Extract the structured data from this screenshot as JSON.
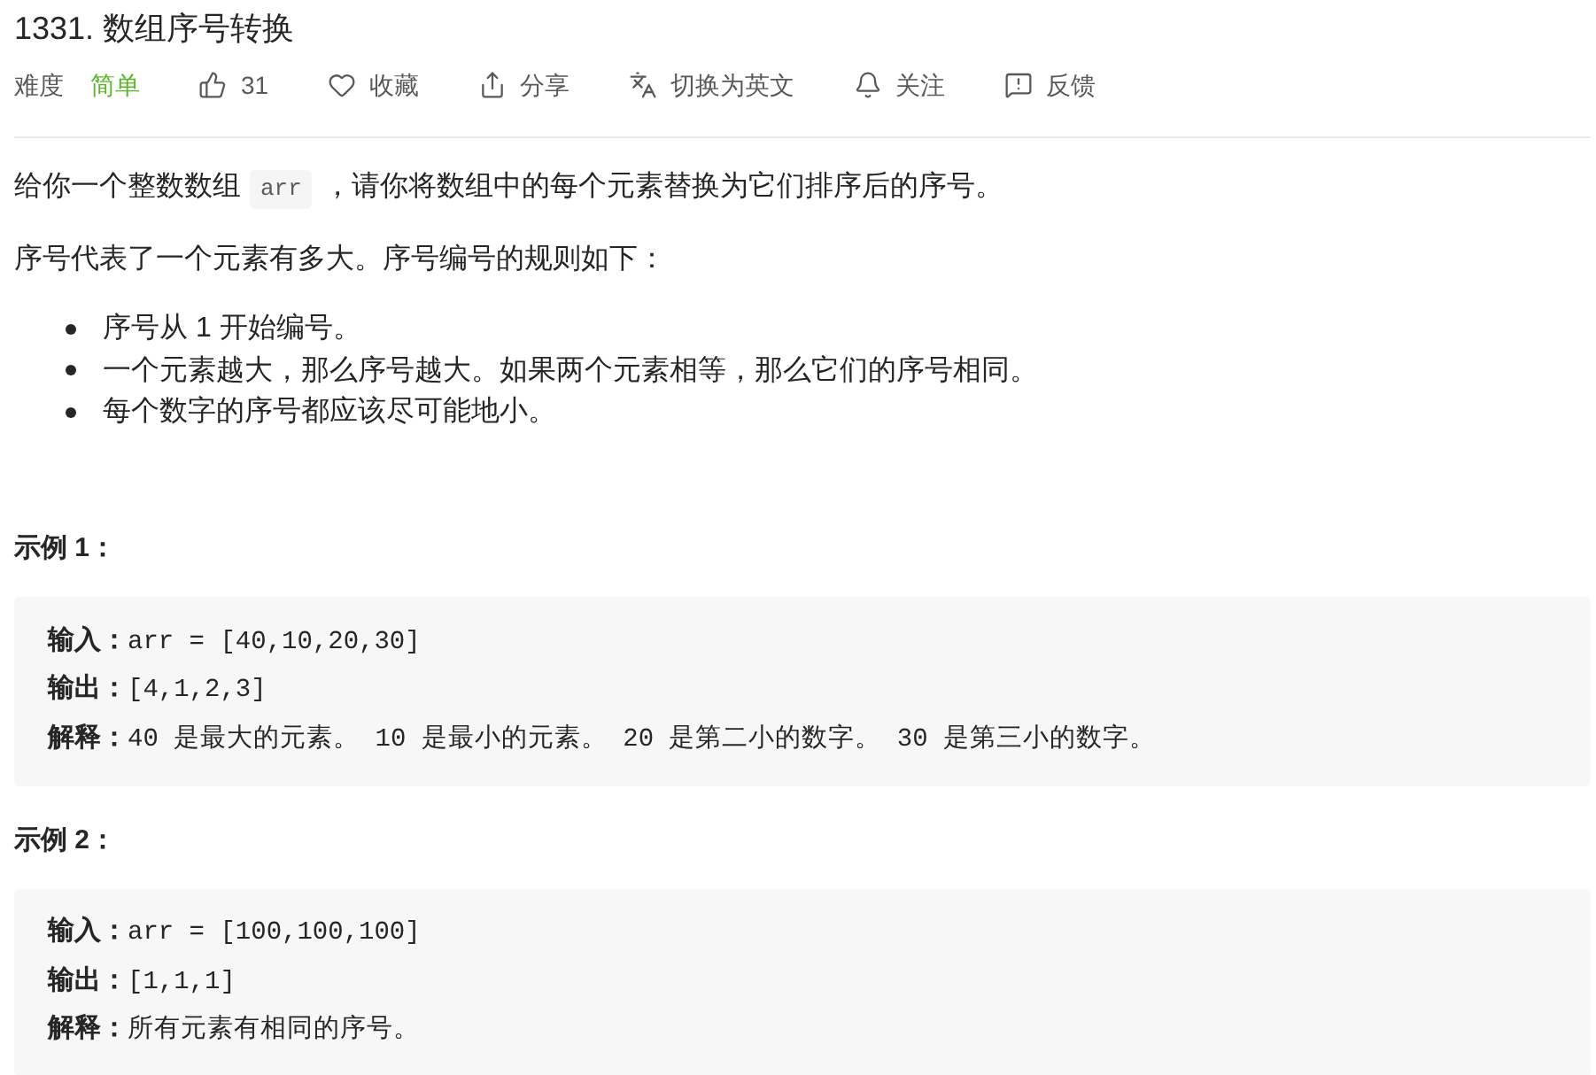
{
  "problem": {
    "title": "1331. 数组序号转换"
  },
  "meta": {
    "difficulty": {
      "label": "难度",
      "value": "简单",
      "kind": "easy"
    },
    "actions": [
      {
        "kind": "like",
        "label": "31"
      },
      {
        "kind": "favorite",
        "label": "收藏"
      },
      {
        "kind": "share",
        "label": "分享"
      },
      {
        "kind": "translate",
        "label": "切换为英文"
      },
      {
        "kind": "follow",
        "label": "关注"
      },
      {
        "kind": "feedback",
        "label": "反馈"
      }
    ]
  },
  "description": {
    "intro": {
      "before": "给你一个整数数组",
      "code": "arr",
      "after": "，请你将数组中的每个元素替换为它们排序后的序号。"
    },
    "rules_intro": "序号代表了一个元素有多大。序号编号的规则如下：",
    "rules": [
      "序号从 1 开始编号。",
      "一个元素越大，那么序号越大。如果两个元素相等，那么它们的序号相同。",
      "每个数字的序号都应该尽可能地小。"
    ]
  },
  "examples": [
    {
      "heading": "示例 1：",
      "lines": [
        {
          "label": "输入：",
          "value": "arr = [40,10,20,30]"
        },
        {
          "label": "输出：",
          "value": "[4,1,2,3]"
        },
        {
          "label": "解释：",
          "value": "40 是最大的元素。 10 是最小的元素。 20 是第二小的数字。 30 是第三小的数字。"
        }
      ]
    },
    {
      "heading": "示例 2：",
      "lines": [
        {
          "label": "输入：",
          "value": "arr = [100,100,100]"
        },
        {
          "label": "输出：",
          "value": "[1,1,1]"
        },
        {
          "label": "解释：",
          "value": "所有元素有相同的序号。"
        }
      ]
    }
  ]
}
